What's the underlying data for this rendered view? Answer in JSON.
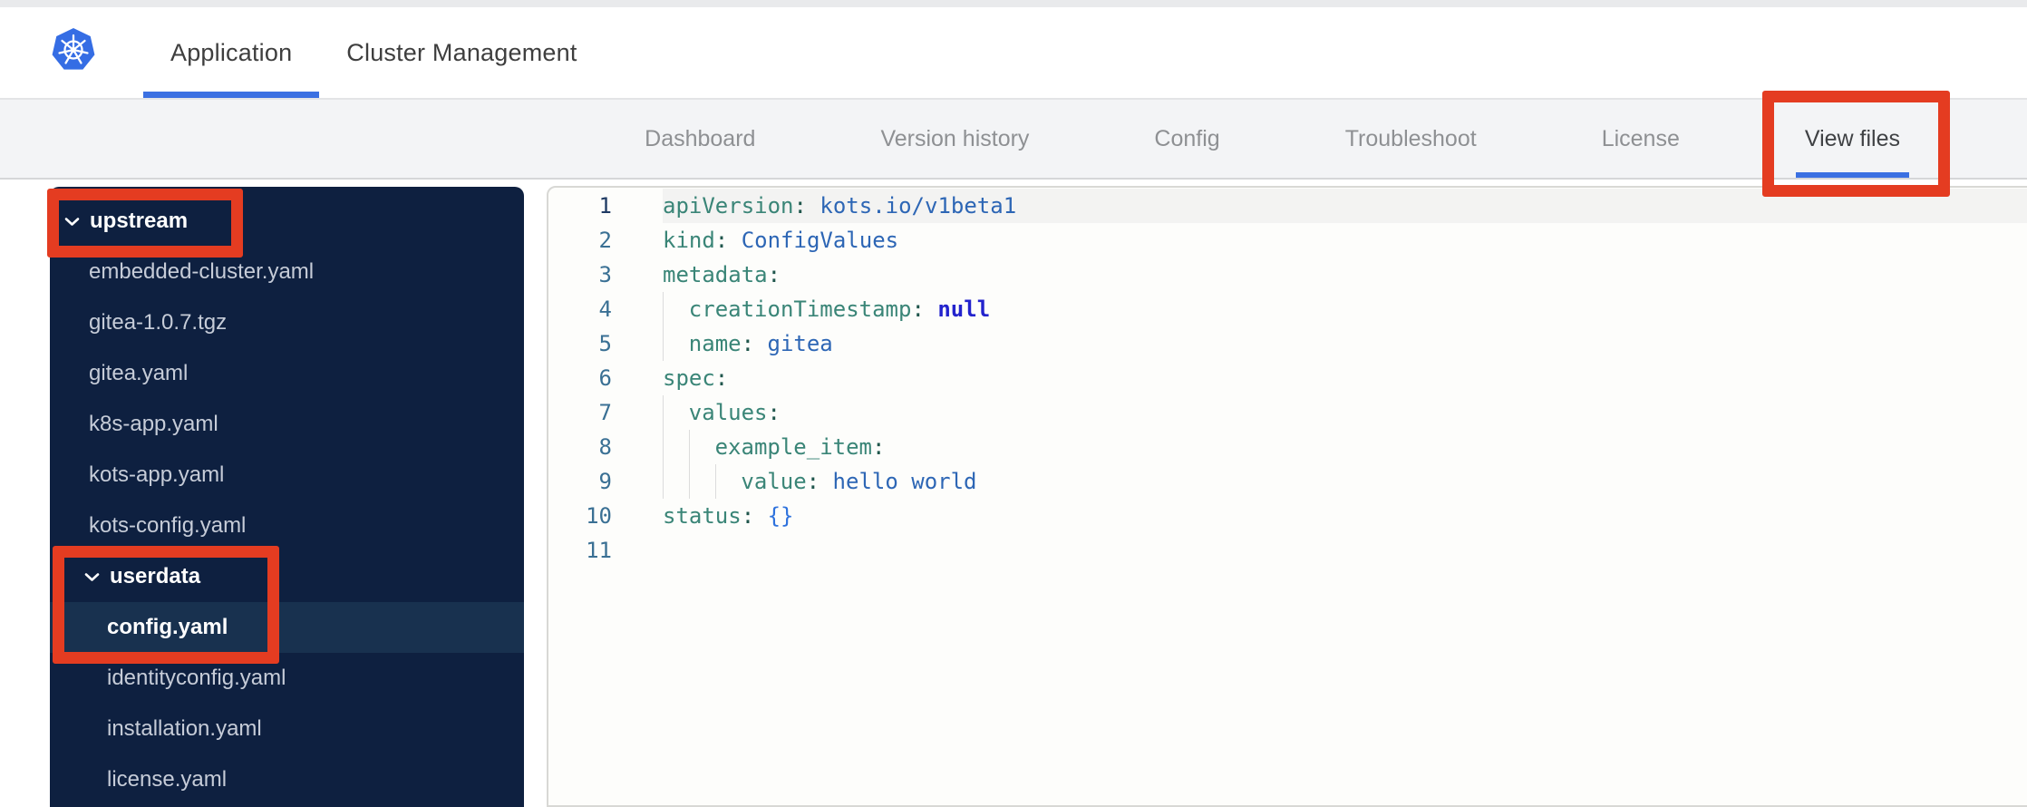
{
  "colors": {
    "red": "#e43c21",
    "blue_underline": "#3b70e2",
    "k8s_blue": "#356de4",
    "sidebar_bg": "#0e2040",
    "row_selected": "#18314f",
    "file_text": "#c6ccd8",
    "nav_text": "#8e9093",
    "nav_active_text": "#3f4144",
    "editor_bg": "#fdfdfb",
    "editor_border": "#d8d8d5",
    "active_line": "#f3f3f2",
    "guide": "#dcdcdc",
    "gutter_num": "#3a7094",
    "gutter_active": "#1f3a63",
    "tk_key": "#3a8577",
    "tk_colon": "#20564c",
    "tk_val": "#2d66b5",
    "tk_const": "#2323cd",
    "tk_brace": "#2e72dd"
  },
  "header": {
    "tabs": [
      {
        "label": "Application",
        "active": true
      },
      {
        "label": "Cluster Management",
        "active": false
      }
    ]
  },
  "nav": {
    "tabs": [
      {
        "label": "Dashboard",
        "active": false
      },
      {
        "label": "Version history",
        "active": false
      },
      {
        "label": "Config",
        "active": false
      },
      {
        "label": "Troubleshoot",
        "active": false
      },
      {
        "label": "License",
        "active": false
      },
      {
        "label": "View files",
        "active": true
      }
    ]
  },
  "file_tree": {
    "items": [
      {
        "label": "upstream",
        "type": "folder",
        "level": 0,
        "expanded": true
      },
      {
        "label": "embedded-cluster.yaml",
        "type": "file",
        "level": 1
      },
      {
        "label": "gitea-1.0.7.tgz",
        "type": "file",
        "level": 1
      },
      {
        "label": "gitea.yaml",
        "type": "file",
        "level": 1
      },
      {
        "label": "k8s-app.yaml",
        "type": "file",
        "level": 1
      },
      {
        "label": "kots-app.yaml",
        "type": "file",
        "level": 1
      },
      {
        "label": "kots-config.yaml",
        "type": "file",
        "level": 1
      },
      {
        "label": "userdata",
        "type": "folder",
        "level": 1,
        "expanded": true
      },
      {
        "label": "config.yaml",
        "type": "file",
        "level": 2,
        "selected": true
      },
      {
        "label": "identityconfig.yaml",
        "type": "file",
        "level": 2
      },
      {
        "label": "installation.yaml",
        "type": "file",
        "level": 2
      },
      {
        "label": "license.yaml",
        "type": "file",
        "level": 2
      }
    ]
  },
  "editor": {
    "lines": [
      {
        "num": "1",
        "indent": 0,
        "active": true,
        "tokens": [
          [
            "key",
            "apiVersion"
          ],
          [
            "colon",
            ": "
          ],
          [
            "val",
            "kots.io/v1beta1"
          ]
        ]
      },
      {
        "num": "2",
        "indent": 0,
        "tokens": [
          [
            "key",
            "kind"
          ],
          [
            "colon",
            ": "
          ],
          [
            "val",
            "ConfigValues"
          ]
        ]
      },
      {
        "num": "3",
        "indent": 0,
        "tokens": [
          [
            "key",
            "metadata"
          ],
          [
            "colon",
            ":"
          ]
        ]
      },
      {
        "num": "4",
        "indent": 2,
        "tokens": [
          [
            "key",
            "creationTimestamp"
          ],
          [
            "colon",
            ": "
          ],
          [
            "const",
            "null"
          ]
        ]
      },
      {
        "num": "5",
        "indent": 2,
        "tokens": [
          [
            "key",
            "name"
          ],
          [
            "colon",
            ": "
          ],
          [
            "val",
            "gitea"
          ]
        ]
      },
      {
        "num": "6",
        "indent": 0,
        "tokens": [
          [
            "key",
            "spec"
          ],
          [
            "colon",
            ":"
          ]
        ]
      },
      {
        "num": "7",
        "indent": 2,
        "tokens": [
          [
            "key",
            "values"
          ],
          [
            "colon",
            ":"
          ]
        ]
      },
      {
        "num": "8",
        "indent": 4,
        "tokens": [
          [
            "key",
            "example_item"
          ],
          [
            "colon",
            ":"
          ]
        ]
      },
      {
        "num": "9",
        "indent": 6,
        "tokens": [
          [
            "key",
            "value"
          ],
          [
            "colon",
            ": "
          ],
          [
            "val",
            "hello world"
          ]
        ]
      },
      {
        "num": "10",
        "indent": 0,
        "tokens": [
          [
            "key",
            "status"
          ],
          [
            "colon",
            ": "
          ],
          [
            "brace",
            "{}"
          ]
        ]
      },
      {
        "num": "11",
        "indent": 0,
        "tokens": []
      }
    ]
  },
  "annotations": {
    "boxes": [
      {
        "target": "upstream-folder"
      },
      {
        "target": "userdata-folder-and-config-yaml"
      },
      {
        "target": "view-files-tab"
      }
    ]
  }
}
